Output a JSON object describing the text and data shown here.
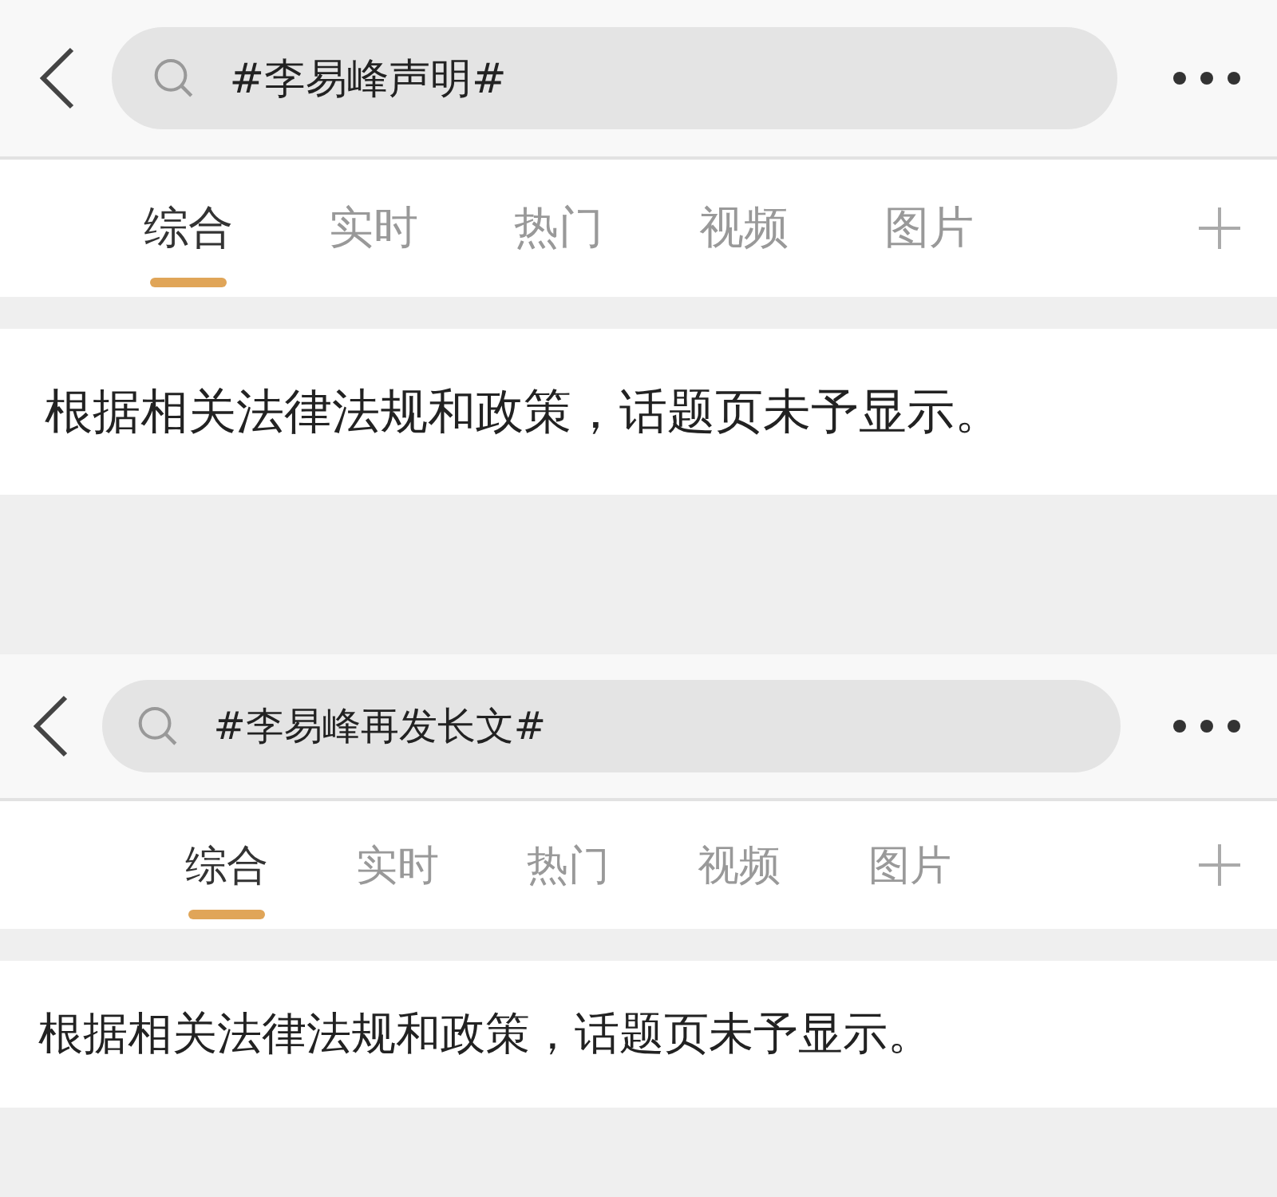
{
  "screens": [
    {
      "search": {
        "value": "#李易峰声明#"
      },
      "tabs": [
        {
          "label": "综合",
          "selected": true
        },
        {
          "label": "实时",
          "selected": false
        },
        {
          "label": "热门",
          "selected": false
        },
        {
          "label": "视频",
          "selected": false
        },
        {
          "label": "图片",
          "selected": false
        }
      ],
      "notice": "根据相关法律法规和政策，话题页未予显示。"
    },
    {
      "search": {
        "value": "#李易峰再发长文#"
      },
      "tabs": [
        {
          "label": "综合",
          "selected": true
        },
        {
          "label": "实时",
          "selected": false
        },
        {
          "label": "热门",
          "selected": false
        },
        {
          "label": "视频",
          "selected": false
        },
        {
          "label": "图片",
          "selected": false
        }
      ],
      "notice": "根据相关法律法规和政策，话题页未予显示。"
    }
  ]
}
